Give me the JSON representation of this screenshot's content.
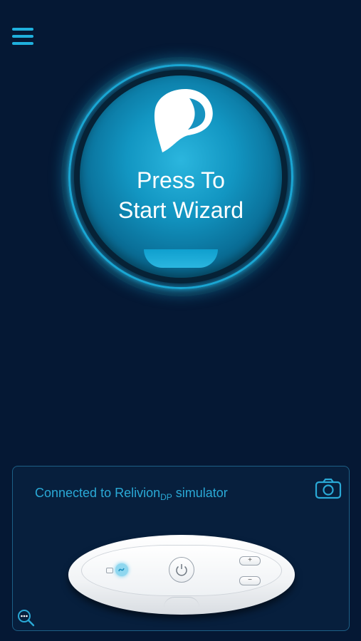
{
  "header": {
    "menu_icon": "hamburger-menu-icon"
  },
  "wizard": {
    "icon": "electrode-pad-icon",
    "label_line1": "Press To",
    "label_line2": "Start Wizard"
  },
  "device_panel": {
    "connected_prefix": "Connected to Relivion",
    "connected_sub": "DP",
    "connected_suffix": " simulator",
    "camera_icon": "camera-icon",
    "zoom_icon": "zoom-more-icon",
    "device_buttons": {
      "plus": "+",
      "minus": "−"
    }
  },
  "colors": {
    "background": "#051834",
    "accent": "#1fb0dd",
    "panel_border": "#1d5f86",
    "text_accent": "#2aa9d6"
  }
}
